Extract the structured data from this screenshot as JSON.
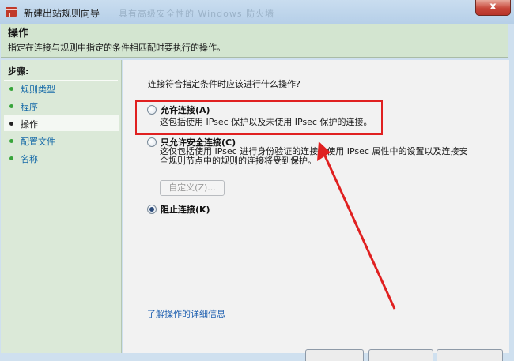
{
  "window": {
    "title": "新建出站规则向导",
    "ghost_title": "具有高级安全性的 Windows 防火墙",
    "close_glyph": "x"
  },
  "header": {
    "title": "操作",
    "description": "指定在连接与规则中指定的条件相匹配时要执行的操作。"
  },
  "steps": {
    "title": "步骤:",
    "items": [
      {
        "label": "规则类型",
        "active": false
      },
      {
        "label": "程序",
        "active": false
      },
      {
        "label": "操作",
        "active": true
      },
      {
        "label": "配置文件",
        "active": false
      },
      {
        "label": "名称",
        "active": false
      }
    ]
  },
  "content": {
    "question": "连接符合指定条件时应该进行什么操作?",
    "options": [
      {
        "label": "允许连接(A)",
        "description": [
          "这包括使用 IPsec 保护以及未使用 IPsec 保护的连接。"
        ],
        "checked": false
      },
      {
        "label": "只允许安全连接(C)",
        "description": [
          "这仅包括使用 IPsec 进行身份验证的连接。使用 IPsec 属性中的设置以及连接安",
          "全规则节点中的规则的连接将受到保护。"
        ],
        "checked": false
      },
      {
        "label": "阻止连接(K)",
        "description": [],
        "checked": true
      }
    ],
    "customize_button": "自定义(Z)...",
    "learn_more_link": "了解操作的详细信息"
  },
  "colors": {
    "annotation": "#e02020",
    "link": "#1d5fb0",
    "step_bullet": "#37a43a"
  }
}
